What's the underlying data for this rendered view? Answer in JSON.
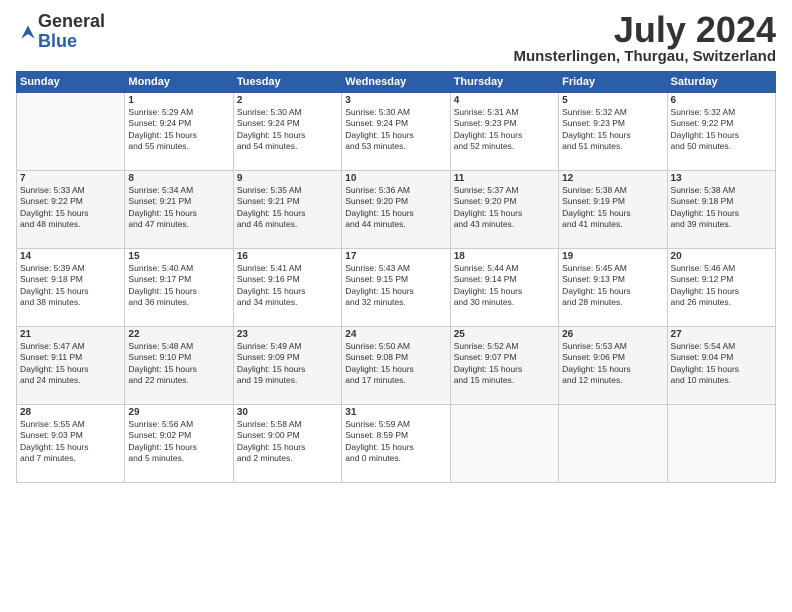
{
  "header": {
    "logo_line1": "General",
    "logo_line2": "Blue",
    "title": "July 2024",
    "subtitle": "Munsterlingen, Thurgau, Switzerland"
  },
  "columns": [
    "Sunday",
    "Monday",
    "Tuesday",
    "Wednesday",
    "Thursday",
    "Friday",
    "Saturday"
  ],
  "weeks": [
    [
      {
        "num": "",
        "info": ""
      },
      {
        "num": "1",
        "info": "Sunrise: 5:29 AM\nSunset: 9:24 PM\nDaylight: 15 hours\nand 55 minutes."
      },
      {
        "num": "2",
        "info": "Sunrise: 5:30 AM\nSunset: 9:24 PM\nDaylight: 15 hours\nand 54 minutes."
      },
      {
        "num": "3",
        "info": "Sunrise: 5:30 AM\nSunset: 9:24 PM\nDaylight: 15 hours\nand 53 minutes."
      },
      {
        "num": "4",
        "info": "Sunrise: 5:31 AM\nSunset: 9:23 PM\nDaylight: 15 hours\nand 52 minutes."
      },
      {
        "num": "5",
        "info": "Sunrise: 5:32 AM\nSunset: 9:23 PM\nDaylight: 15 hours\nand 51 minutes."
      },
      {
        "num": "6",
        "info": "Sunrise: 5:32 AM\nSunset: 9:22 PM\nDaylight: 15 hours\nand 50 minutes."
      }
    ],
    [
      {
        "num": "7",
        "info": "Sunrise: 5:33 AM\nSunset: 9:22 PM\nDaylight: 15 hours\nand 48 minutes."
      },
      {
        "num": "8",
        "info": "Sunrise: 5:34 AM\nSunset: 9:21 PM\nDaylight: 15 hours\nand 47 minutes."
      },
      {
        "num": "9",
        "info": "Sunrise: 5:35 AM\nSunset: 9:21 PM\nDaylight: 15 hours\nand 46 minutes."
      },
      {
        "num": "10",
        "info": "Sunrise: 5:36 AM\nSunset: 9:20 PM\nDaylight: 15 hours\nand 44 minutes."
      },
      {
        "num": "11",
        "info": "Sunrise: 5:37 AM\nSunset: 9:20 PM\nDaylight: 15 hours\nand 43 minutes."
      },
      {
        "num": "12",
        "info": "Sunrise: 5:38 AM\nSunset: 9:19 PM\nDaylight: 15 hours\nand 41 minutes."
      },
      {
        "num": "13",
        "info": "Sunrise: 5:38 AM\nSunset: 9:18 PM\nDaylight: 15 hours\nand 39 minutes."
      }
    ],
    [
      {
        "num": "14",
        "info": "Sunrise: 5:39 AM\nSunset: 9:18 PM\nDaylight: 15 hours\nand 38 minutes."
      },
      {
        "num": "15",
        "info": "Sunrise: 5:40 AM\nSunset: 9:17 PM\nDaylight: 15 hours\nand 36 minutes."
      },
      {
        "num": "16",
        "info": "Sunrise: 5:41 AM\nSunset: 9:16 PM\nDaylight: 15 hours\nand 34 minutes."
      },
      {
        "num": "17",
        "info": "Sunrise: 5:43 AM\nSunset: 9:15 PM\nDaylight: 15 hours\nand 32 minutes."
      },
      {
        "num": "18",
        "info": "Sunrise: 5:44 AM\nSunset: 9:14 PM\nDaylight: 15 hours\nand 30 minutes."
      },
      {
        "num": "19",
        "info": "Sunrise: 5:45 AM\nSunset: 9:13 PM\nDaylight: 15 hours\nand 28 minutes."
      },
      {
        "num": "20",
        "info": "Sunrise: 5:46 AM\nSunset: 9:12 PM\nDaylight: 15 hours\nand 26 minutes."
      }
    ],
    [
      {
        "num": "21",
        "info": "Sunrise: 5:47 AM\nSunset: 9:11 PM\nDaylight: 15 hours\nand 24 minutes."
      },
      {
        "num": "22",
        "info": "Sunrise: 5:48 AM\nSunset: 9:10 PM\nDaylight: 15 hours\nand 22 minutes."
      },
      {
        "num": "23",
        "info": "Sunrise: 5:49 AM\nSunset: 9:09 PM\nDaylight: 15 hours\nand 19 minutes."
      },
      {
        "num": "24",
        "info": "Sunrise: 5:50 AM\nSunset: 9:08 PM\nDaylight: 15 hours\nand 17 minutes."
      },
      {
        "num": "25",
        "info": "Sunrise: 5:52 AM\nSunset: 9:07 PM\nDaylight: 15 hours\nand 15 minutes."
      },
      {
        "num": "26",
        "info": "Sunrise: 5:53 AM\nSunset: 9:06 PM\nDaylight: 15 hours\nand 12 minutes."
      },
      {
        "num": "27",
        "info": "Sunrise: 5:54 AM\nSunset: 9:04 PM\nDaylight: 15 hours\nand 10 minutes."
      }
    ],
    [
      {
        "num": "28",
        "info": "Sunrise: 5:55 AM\nSunset: 9:03 PM\nDaylight: 15 hours\nand 7 minutes."
      },
      {
        "num": "29",
        "info": "Sunrise: 5:56 AM\nSunset: 9:02 PM\nDaylight: 15 hours\nand 5 minutes."
      },
      {
        "num": "30",
        "info": "Sunrise: 5:58 AM\nSunset: 9:00 PM\nDaylight: 15 hours\nand 2 minutes."
      },
      {
        "num": "31",
        "info": "Sunrise: 5:59 AM\nSunset: 8:59 PM\nDaylight: 15 hours\nand 0 minutes."
      },
      {
        "num": "",
        "info": ""
      },
      {
        "num": "",
        "info": ""
      },
      {
        "num": "",
        "info": ""
      }
    ]
  ]
}
